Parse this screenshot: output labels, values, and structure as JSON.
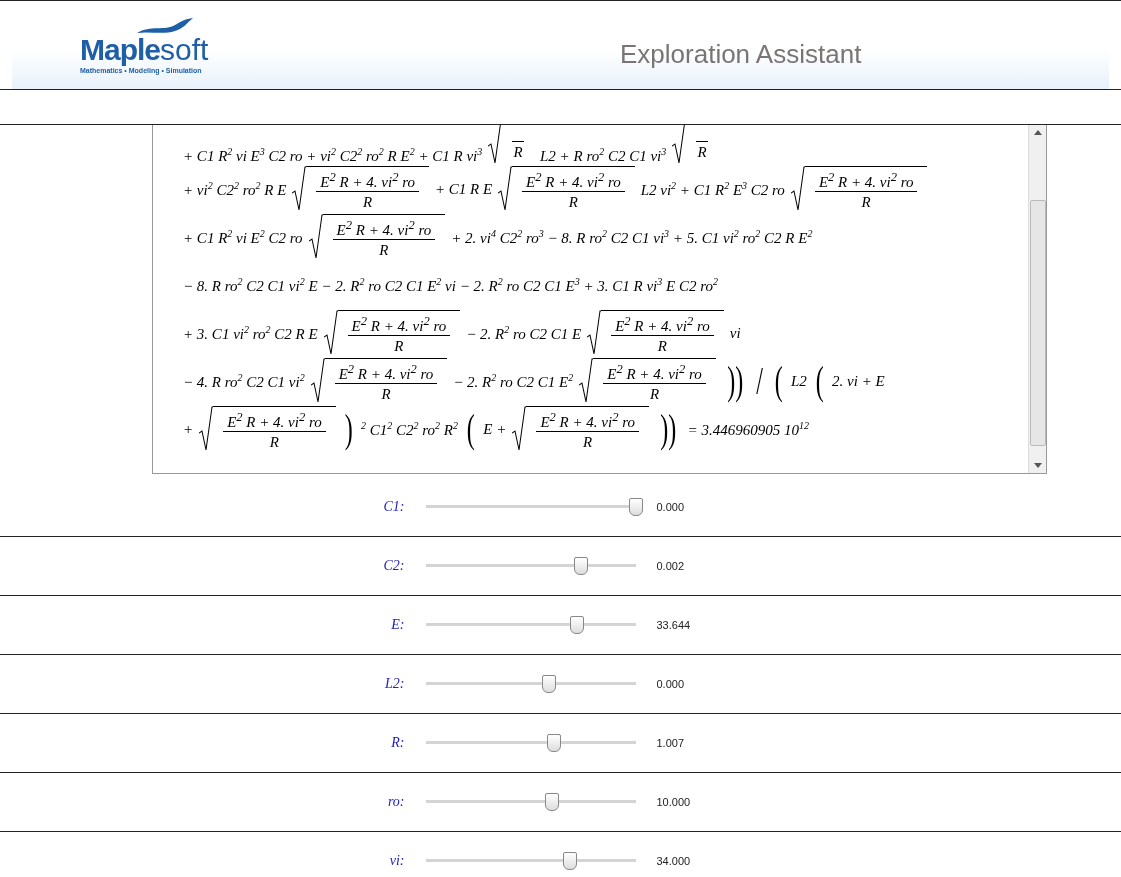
{
  "header": {
    "logo": {
      "brand_bold": "Maple",
      "brand_light": "soft",
      "tagline": "Mathematics • Modeling • Simulation"
    },
    "title": "Exploration Assistant"
  },
  "formula": {
    "lines": [
      [
        {
          "kind": "text",
          "text": "+ C1 R$^{2}$ vi E$^{3}$ C2 ro + vi$^{2}$ C2$^{2}$ ro$^{2}$ R E$^{2}$ + C1 R vi$^{3}$"
        },
        {
          "kind": "root",
          "den": "R"
        },
        {
          "kind": "text",
          "text": "L2 + R ro$^{2}$ C2 C1 vi$^{3}$"
        },
        {
          "kind": "root",
          "den": "R"
        }
      ],
      [
        {
          "kind": "text",
          "text": "+ vi$^{2}$ C2$^{2}$ ro$^{2}$ R E"
        },
        {
          "kind": "root",
          "num": "E$^{2}$ R + 4. vi$^{2}$ ro",
          "den": "R"
        },
        {
          "kind": "text",
          "text": "+ C1 R E"
        },
        {
          "kind": "root",
          "num": "E$^{2}$ R + 4. vi$^{2}$ ro",
          "den": "R"
        },
        {
          "kind": "text",
          "text": "L2 vi$^{2}$ + C1 R$^{2}$ E$^{3}$ C2 ro"
        },
        {
          "kind": "root",
          "num": "E$^{2}$ R + 4. vi$^{2}$ ro",
          "den": "R"
        }
      ],
      [
        {
          "kind": "text",
          "text": "+ C1 R$^{2}$ vi E$^{2}$ C2 ro"
        },
        {
          "kind": "root",
          "num": "E$^{2}$ R + 4. vi$^{2}$ ro",
          "den": "R"
        },
        {
          "kind": "text",
          "text": "+ 2. vi$^{4}$ C2$^{2}$ ro$^{3}$ − 8. R ro$^{2}$ C2 C1 vi$^{3}$ + 5. C1 vi$^{2}$ ro$^{2}$ C2 R E$^{2}$"
        }
      ],
      [
        {
          "kind": "text",
          "text": "− 8. R ro$^{2}$ C2 C1 vi$^{2}$ E − 2. R$^{2}$ ro C2 C1 E$^{2}$ vi − 2. R$^{2}$ ro C2 C1 E$^{3}$ + 3. C1 R vi$^{3}$ E C2 ro$^{2}$"
        }
      ],
      [
        {
          "kind": "text",
          "text": "+ 3. C1 vi$^{2}$ ro$^{2}$ C2 R E"
        },
        {
          "kind": "root",
          "num": "E$^{2}$ R + 4. vi$^{2}$ ro",
          "den": "R"
        },
        {
          "kind": "text",
          "text": "− 2. R$^{2}$ ro C2 C1 E"
        },
        {
          "kind": "root",
          "num": "E$^{2}$ R + 4. vi$^{2}$ ro",
          "den": "R"
        },
        {
          "kind": "text",
          "text": "vi"
        }
      ],
      [
        {
          "kind": "text",
          "text": "− 4. R ro$^{2}$ C2 C1 vi$^{2}$"
        },
        {
          "kind": "root",
          "num": "E$^{2}$ R + 4. vi$^{2}$ ro",
          "den": "R"
        },
        {
          "kind": "text",
          "text": "− 2. R$^{2}$ ro C2 C1 E$^{2}$"
        },
        {
          "kind": "root",
          "num": "E$^{2}$ R + 4. vi$^{2}$ ro",
          "den": "R"
        },
        {
          "kind": "big",
          "text": "))"
        },
        {
          "kind": "big",
          "text": "/"
        },
        {
          "kind": "big",
          "text": "("
        },
        {
          "kind": "text",
          "text": "L2"
        },
        {
          "kind": "big",
          "text": "("
        },
        {
          "kind": "text",
          "text": "2. vi + E"
        }
      ],
      [
        {
          "kind": "text",
          "text": "+"
        },
        {
          "kind": "root",
          "num": "E$^{2}$ R + 4. vi$^{2}$ ro",
          "den": "R"
        },
        {
          "kind": "big",
          "text": ")"
        },
        {
          "kind": "text",
          "text": "$^{2}$ C1$^{2}$ C2$^{2}$ ro$^{2}$ R$^{2}$"
        },
        {
          "kind": "big",
          "text": "("
        },
        {
          "kind": "text",
          "text": "E +"
        },
        {
          "kind": "root",
          "num": "E$^{2}$ R + 4. vi$^{2}$ ro",
          "den": "R"
        },
        {
          "kind": "big",
          "text": "))"
        },
        {
          "kind": "text",
          "text": "= 3.446960905 10$^{12}$"
        }
      ]
    ]
  },
  "sliders": [
    {
      "label": "C1:",
      "level": 1.0,
      "value": "0.000"
    },
    {
      "label": "C2:",
      "level": 0.74,
      "value": "0.002"
    },
    {
      "label": "E:",
      "level": 0.72,
      "value": "33.644"
    },
    {
      "label": "L2:",
      "level": 0.59,
      "value": "0.000"
    },
    {
      "label": "R:",
      "level": 0.61,
      "value": "1.007"
    },
    {
      "label": "ro:",
      "level": 0.6,
      "value": "10.000"
    },
    {
      "label": "vi:",
      "level": 0.69,
      "value": "34.000"
    }
  ]
}
